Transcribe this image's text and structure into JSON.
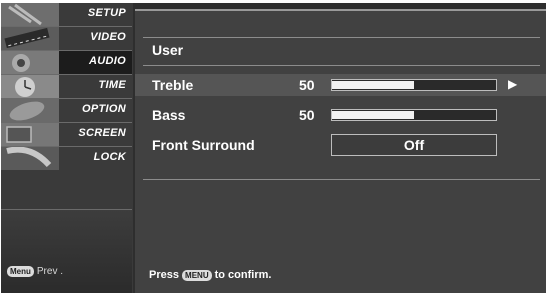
{
  "sidebar": {
    "items": [
      {
        "label": "SETUP",
        "icon": "setup-thumbnail-icon"
      },
      {
        "label": "VIDEO",
        "icon": "video-thumbnail-icon"
      },
      {
        "label": "AUDIO",
        "icon": "audio-thumbnail-icon"
      },
      {
        "label": "TIME",
        "icon": "time-thumbnail-icon"
      },
      {
        "label": "OPTION",
        "icon": "option-thumbnail-icon"
      },
      {
        "label": "SCREEN",
        "icon": "screen-thumbnail-icon"
      },
      {
        "label": "LOCK",
        "icon": "lock-thumbnail-icon"
      }
    ],
    "active_item": "AUDIO",
    "prev": {
      "key": "Menu",
      "text": "Prev ."
    }
  },
  "panel": {
    "header": "User",
    "rows": [
      {
        "label": "Treble",
        "value": "50",
        "level": 0.5
      },
      {
        "label": "Bass",
        "value": "50",
        "level": 0.5
      },
      {
        "label": "Front Surround",
        "value": "Off"
      }
    ],
    "arrow": "▶"
  },
  "footer": {
    "prefix": "Press",
    "key": "MENU",
    "suffix": "to confirm."
  },
  "colors": {
    "background": "#2e2e2e",
    "highlight": "#555555",
    "text": "#ffffff"
  }
}
